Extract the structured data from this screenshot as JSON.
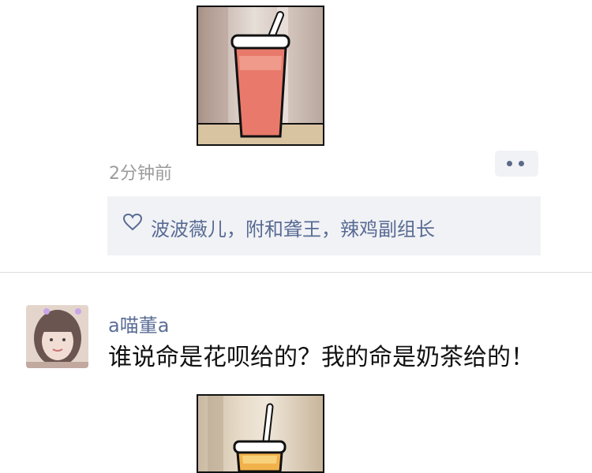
{
  "post": {
    "timestamp": "2分钟前",
    "likes_text": "波波薇儿，附和聋王，辣鸡副组长",
    "icons": {
      "like": "heart-outline-icon",
      "more": "more-dots-icon"
    }
  },
  "comment": {
    "username": "a喵董a",
    "text": "谁说命是花呗给的？我的命是奶茶给的！"
  },
  "colors": {
    "name_blue": "#586b95",
    "timestamp_gray": "#9b9b9b",
    "panel_bg": "#f1f2f5",
    "divider": "#dedede"
  }
}
